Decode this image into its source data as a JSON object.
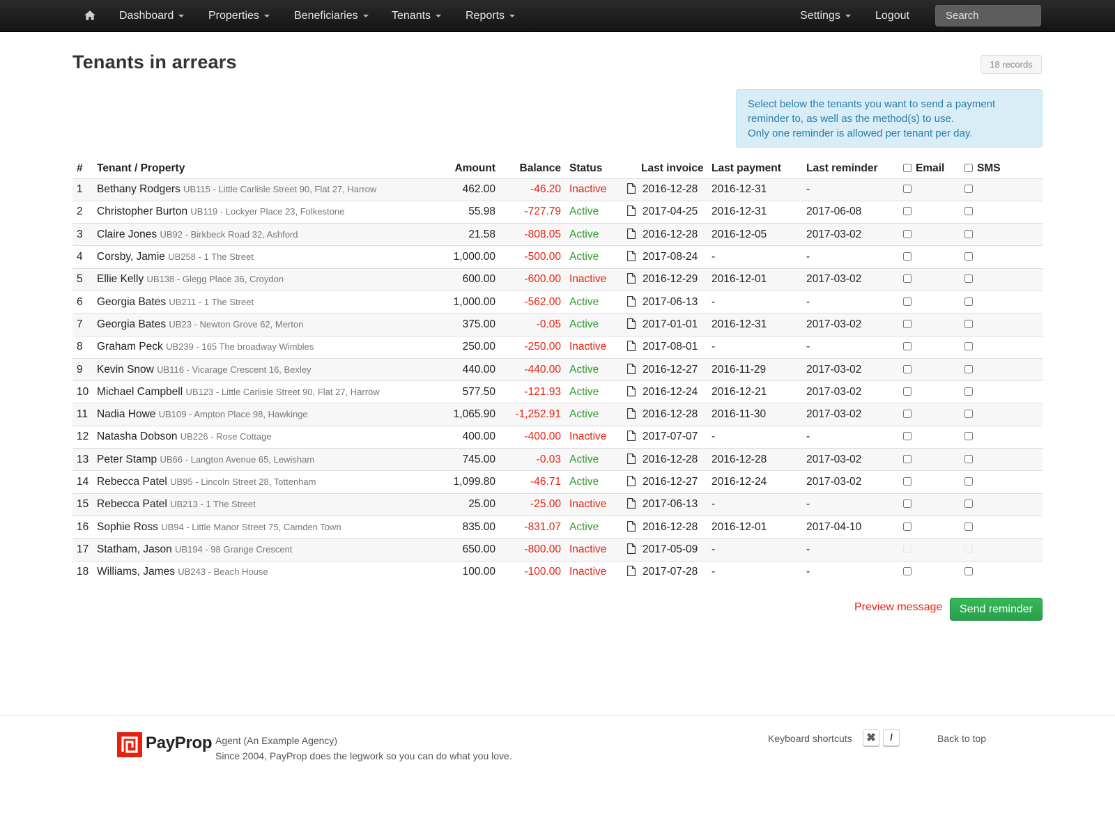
{
  "nav": {
    "items": [
      {
        "label": "Dashboard",
        "caret": true
      },
      {
        "label": "Properties",
        "caret": true
      },
      {
        "label": "Beneficiaries",
        "caret": true
      },
      {
        "label": "Tenants",
        "caret": true
      },
      {
        "label": "Reports",
        "caret": true
      }
    ],
    "settings_label": "Settings",
    "logout_label": "Logout",
    "search_placeholder": "Search"
  },
  "page": {
    "title": "Tenants in arrears",
    "records_badge": "18 records",
    "info_lines": [
      "Select below the tenants you want to send a payment",
      "reminder to, as well as the method(s) to use.",
      "Only one reminder is allowed per tenant per day."
    ]
  },
  "table": {
    "headers": {
      "num": "#",
      "tenant": "Tenant / Property",
      "amount": "Amount",
      "balance": "Balance",
      "status": "Status",
      "last_invoice": "Last invoice",
      "last_payment": "Last payment",
      "last_reminder": "Last reminder",
      "email": "Email",
      "sms": "SMS"
    },
    "rows": [
      {
        "num": "1",
        "name": "Bethany Rodgers",
        "code": "UB115",
        "address": "Little Carlisle Street 90, Flat 27, Harrow",
        "amount": "462.00",
        "balance": "-46.20",
        "status": "Inactive",
        "last_invoice": "2016-12-28",
        "last_payment": "2016-12-31",
        "last_reminder": "-",
        "email_disabled": false,
        "sms_disabled": false
      },
      {
        "num": "2",
        "name": "Christopher Burton",
        "code": "UB119",
        "address": "Lockyer Place 23, Folkestone",
        "amount": "55.98",
        "balance": "-727.79",
        "status": "Active",
        "last_invoice": "2017-04-25",
        "last_payment": "2016-12-31",
        "last_reminder": "2017-06-08",
        "email_disabled": false,
        "sms_disabled": false
      },
      {
        "num": "3",
        "name": "Claire Jones",
        "code": "UB92",
        "address": "Birkbeck Road 32, Ashford",
        "amount": "21.58",
        "balance": "-808.05",
        "status": "Active",
        "last_invoice": "2016-12-28",
        "last_payment": "2016-12-05",
        "last_reminder": "2017-03-02",
        "email_disabled": false,
        "sms_disabled": false
      },
      {
        "num": "4",
        "name": "Corsby, Jamie",
        "code": "UB258",
        "address": "1 The Street",
        "amount": "1,000.00",
        "balance": "-500.00",
        "status": "Active",
        "last_invoice": "2017-08-24",
        "last_payment": "-",
        "last_reminder": "-",
        "email_disabled": false,
        "sms_disabled": false
      },
      {
        "num": "5",
        "name": "Ellie Kelly",
        "code": "UB138",
        "address": "Glegg Place 36, Croydon",
        "amount": "600.00",
        "balance": "-600.00",
        "status": "Inactive",
        "last_invoice": "2016-12-29",
        "last_payment": "2016-12-01",
        "last_reminder": "2017-03-02",
        "email_disabled": false,
        "sms_disabled": false
      },
      {
        "num": "6",
        "name": "Georgia Bates",
        "code": "UB211",
        "address": "1 The Street",
        "amount": "1,000.00",
        "balance": "-562.00",
        "status": "Active",
        "last_invoice": "2017-06-13",
        "last_payment": "-",
        "last_reminder": "-",
        "email_disabled": false,
        "sms_disabled": false
      },
      {
        "num": "7",
        "name": "Georgia Bates",
        "code": "UB23",
        "address": "Newton Grove 62, Merton",
        "amount": "375.00",
        "balance": "-0.05",
        "status": "Active",
        "last_invoice": "2017-01-01",
        "last_payment": "2016-12-31",
        "last_reminder": "2017-03-02",
        "email_disabled": false,
        "sms_disabled": false
      },
      {
        "num": "8",
        "name": "Graham Peck",
        "code": "UB239",
        "address": "165 The broadway Wimbles",
        "amount": "250.00",
        "balance": "-250.00",
        "status": "Inactive",
        "last_invoice": "2017-08-01",
        "last_payment": "-",
        "last_reminder": "-",
        "email_disabled": false,
        "sms_disabled": false
      },
      {
        "num": "9",
        "name": "Kevin Snow",
        "code": "UB116",
        "address": "Vicarage Crescent 16, Bexley",
        "amount": "440.00",
        "balance": "-440.00",
        "status": "Active",
        "last_invoice": "2016-12-27",
        "last_payment": "2016-11-29",
        "last_reminder": "2017-03-02",
        "email_disabled": false,
        "sms_disabled": false
      },
      {
        "num": "10",
        "name": "Michael Campbell",
        "code": "UB123",
        "address": "Little Carlisle Street 90, Flat 27, Harrow",
        "amount": "577.50",
        "balance": "-121.93",
        "status": "Active",
        "last_invoice": "2016-12-24",
        "last_payment": "2016-12-21",
        "last_reminder": "2017-03-02",
        "email_disabled": false,
        "sms_disabled": false
      },
      {
        "num": "11",
        "name": "Nadia Howe",
        "code": "UB109",
        "address": "Ampton Place 98, Hawkinge",
        "amount": "1,065.90",
        "balance": "-1,252.91",
        "status": "Active",
        "last_invoice": "2016-12-28",
        "last_payment": "2016-11-30",
        "last_reminder": "2017-03-02",
        "email_disabled": false,
        "sms_disabled": false
      },
      {
        "num": "12",
        "name": "Natasha Dobson",
        "code": "UB226",
        "address": "Rose Cottage",
        "amount": "400.00",
        "balance": "-400.00",
        "status": "Inactive",
        "last_invoice": "2017-07-07",
        "last_payment": "-",
        "last_reminder": "-",
        "email_disabled": false,
        "sms_disabled": false
      },
      {
        "num": "13",
        "name": "Peter Stamp",
        "code": "UB66",
        "address": "Langton Avenue 65, Lewisham",
        "amount": "745.00",
        "balance": "-0.03",
        "status": "Active",
        "last_invoice": "2016-12-28",
        "last_payment": "2016-12-28",
        "last_reminder": "2017-03-02",
        "email_disabled": false,
        "sms_disabled": false
      },
      {
        "num": "14",
        "name": "Rebecca Patel",
        "code": "UB95",
        "address": "Lincoln Street 28, Tottenham",
        "amount": "1,099.80",
        "balance": "-46.71",
        "status": "Active",
        "last_invoice": "2016-12-27",
        "last_payment": "2016-12-24",
        "last_reminder": "2017-03-02",
        "email_disabled": false,
        "sms_disabled": false
      },
      {
        "num": "15",
        "name": "Rebecca Patel",
        "code": "UB213",
        "address": "1 The Street",
        "amount": "25.00",
        "balance": "-25.00",
        "status": "Inactive",
        "last_invoice": "2017-06-13",
        "last_payment": "-",
        "last_reminder": "-",
        "email_disabled": false,
        "sms_disabled": false
      },
      {
        "num": "16",
        "name": "Sophie Ross",
        "code": "UB94",
        "address": "Little Manor Street 75, Camden Town",
        "amount": "835.00",
        "balance": "-831.07",
        "status": "Active",
        "last_invoice": "2016-12-28",
        "last_payment": "2016-12-01",
        "last_reminder": "2017-04-10",
        "email_disabled": false,
        "sms_disabled": false
      },
      {
        "num": "17",
        "name": "Statham, Jason",
        "code": "UB194",
        "address": "98 Grange Crescent",
        "amount": "650.00",
        "balance": "-800.00",
        "status": "Inactive",
        "last_invoice": "2017-05-09",
        "last_payment": "-",
        "last_reminder": "-",
        "email_disabled": true,
        "sms_disabled": true
      },
      {
        "num": "18",
        "name": "Williams, James",
        "code": "UB243",
        "address": "Beach House",
        "amount": "100.00",
        "balance": "-100.00",
        "status": "Inactive",
        "last_invoice": "2017-07-28",
        "last_payment": "-",
        "last_reminder": "-",
        "email_disabled": false,
        "sms_disabled": false
      }
    ]
  },
  "actions": {
    "preview_label": "Preview message",
    "send_label": "Send reminder"
  },
  "footer": {
    "brand": "PayProp",
    "agent": "Agent (An Example Agency)",
    "tagline": "Since 2004, PayProp does the legwork so you can do what you love.",
    "shortcuts_label": "Keyboard shortcuts",
    "shortcut_keys": [
      "⌘",
      "/"
    ],
    "back_to_top": "Back to top"
  },
  "colors": {
    "negative": "#e8210f",
    "active": "#2f9b2f",
    "inactive": "#e8210f",
    "primary_action": "#28a04b",
    "info_background": "#d9edf7",
    "brand_red": "#e8210f"
  },
  "icons": {
    "home": "home-icon",
    "invoice": "document-icon",
    "logo": "payprop-logo-icon"
  }
}
